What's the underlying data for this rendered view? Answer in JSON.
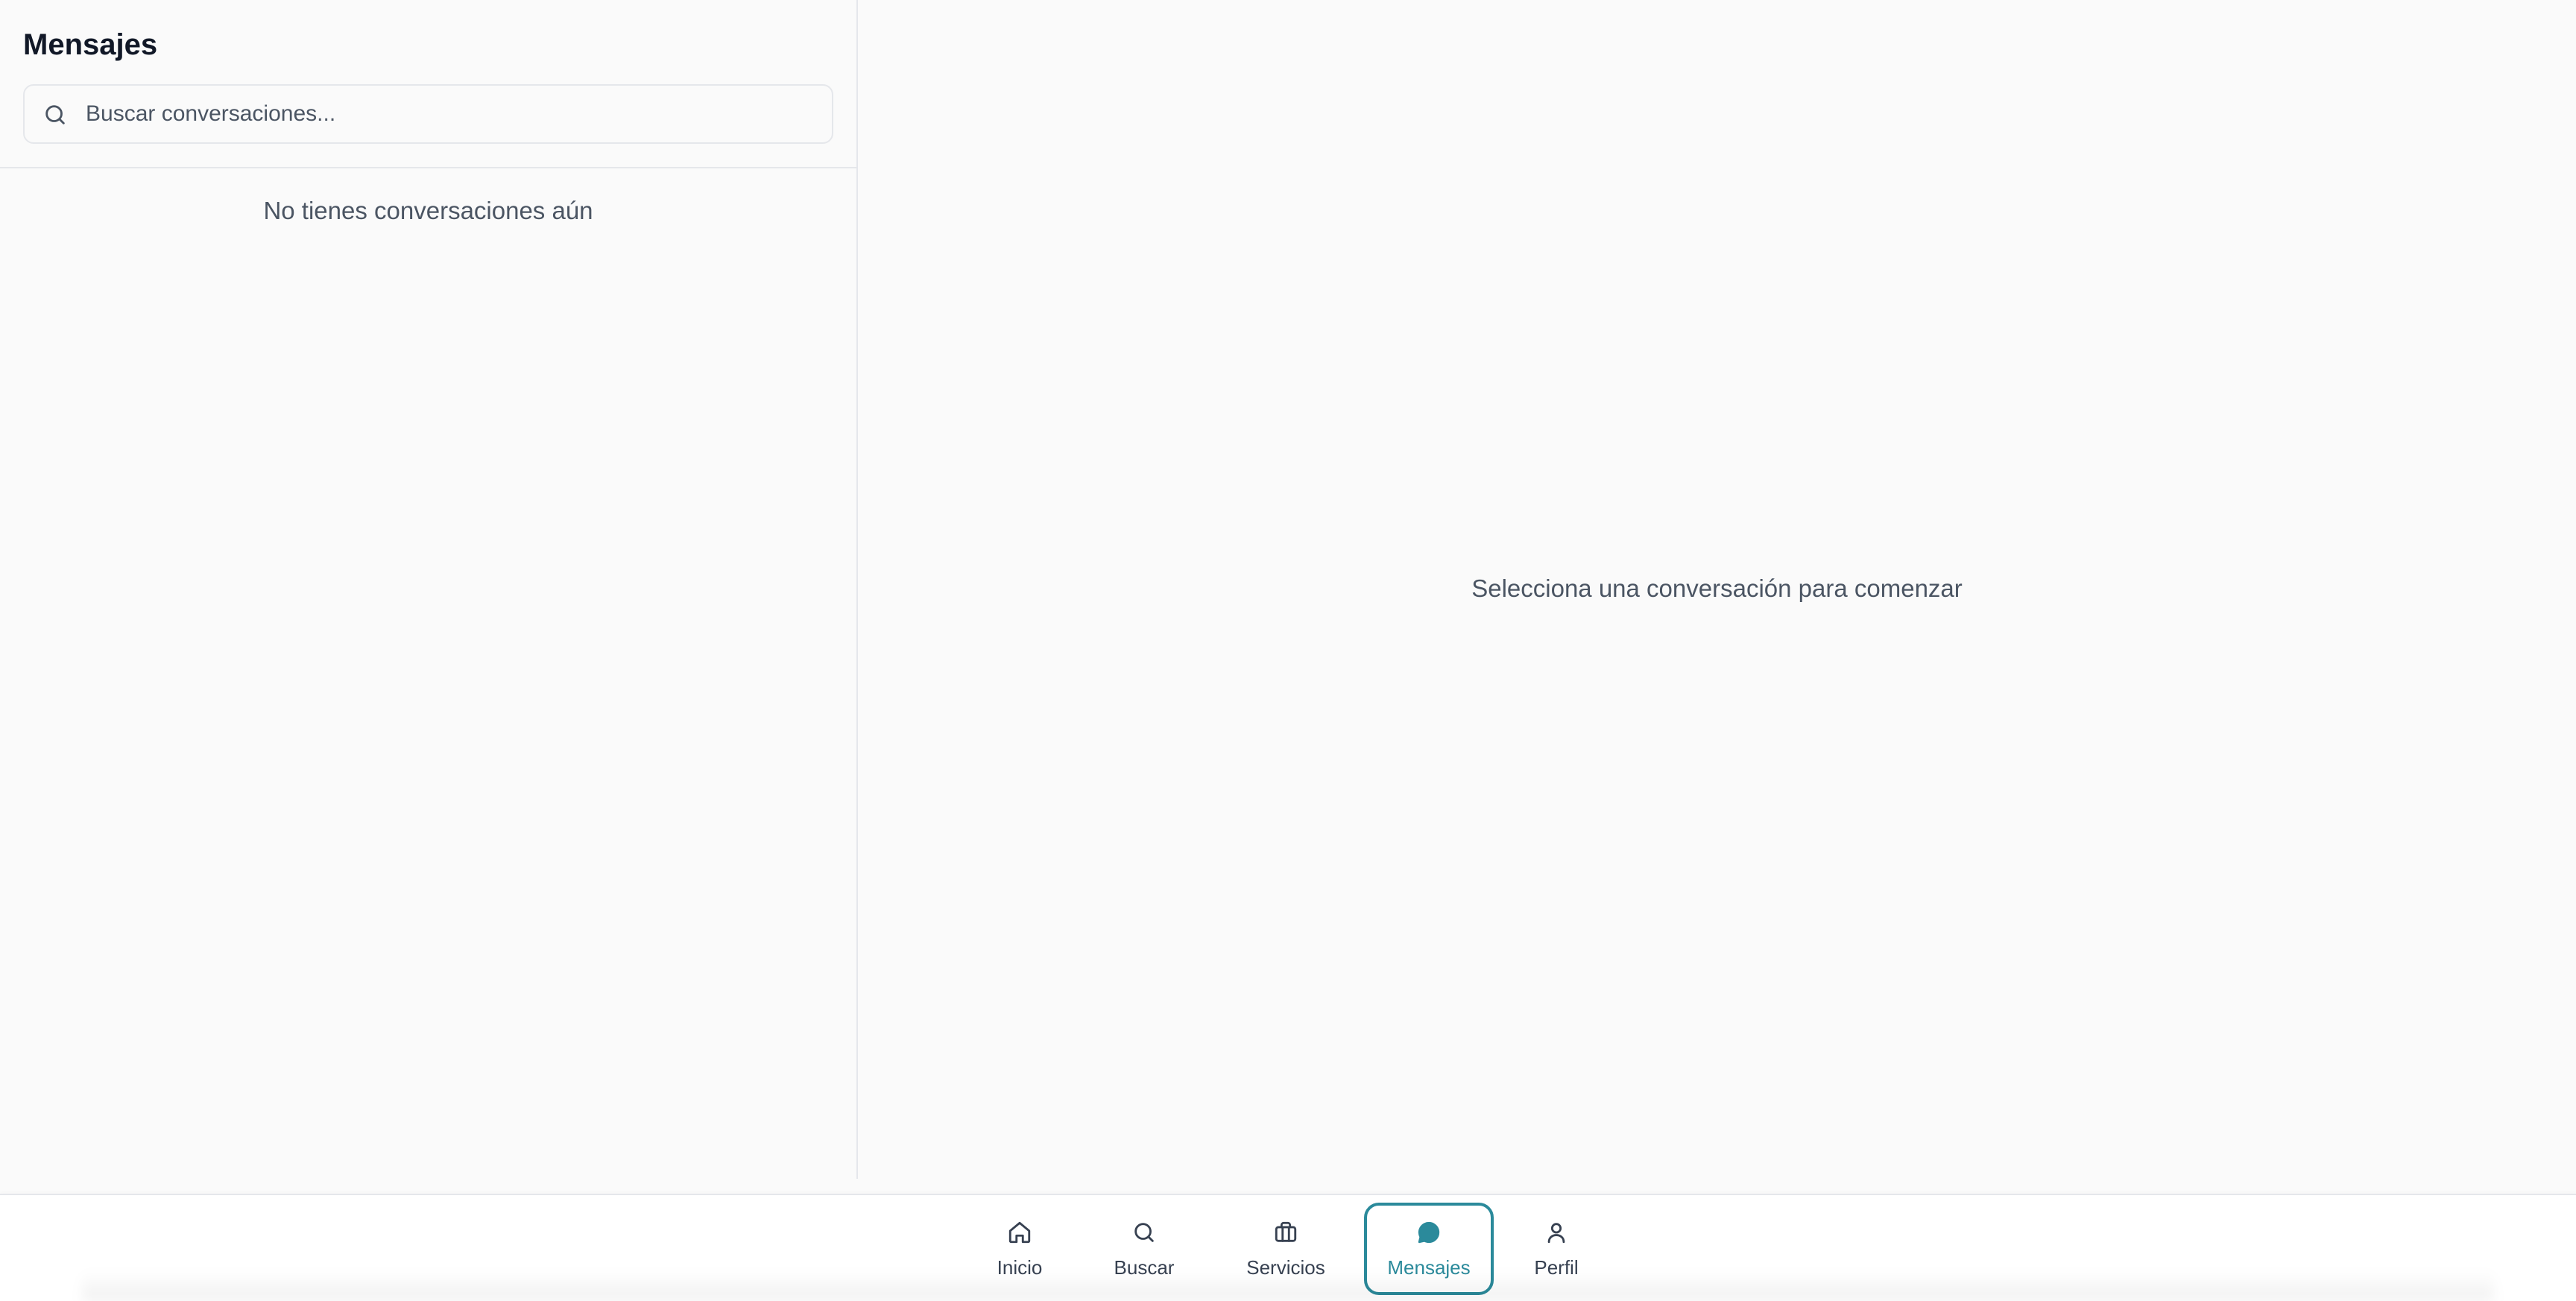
{
  "sidebar": {
    "title": "Mensajes",
    "search": {
      "placeholder": "Buscar conversaciones...",
      "value": "",
      "icon": "search-icon"
    },
    "empty_text": "No tienes conversaciones aún"
  },
  "chat": {
    "placeholder_text": "Selecciona una conversación para comenzar"
  },
  "bottom_nav": {
    "accent_color": "#2b8a9b",
    "items": [
      {
        "label": "Inicio",
        "icon": "home-icon",
        "active": false
      },
      {
        "label": "Buscar",
        "icon": "search-icon",
        "active": false
      },
      {
        "label": "Servicios",
        "icon": "briefcase-icon",
        "active": false
      },
      {
        "label": "Mensajes",
        "icon": "message-circle-icon",
        "active": true
      },
      {
        "label": "Perfil",
        "icon": "user-icon",
        "active": false
      }
    ]
  }
}
